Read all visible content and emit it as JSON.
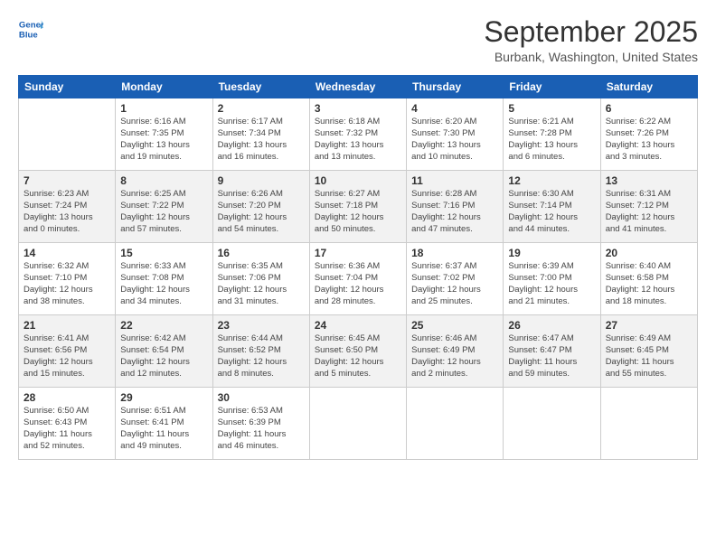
{
  "header": {
    "logo_line1": "General",
    "logo_line2": "Blue",
    "month_title": "September 2025",
    "location": "Burbank, Washington, United States"
  },
  "weekdays": [
    "Sunday",
    "Monday",
    "Tuesday",
    "Wednesday",
    "Thursday",
    "Friday",
    "Saturday"
  ],
  "rows": [
    [
      {
        "day": "",
        "info": ""
      },
      {
        "day": "1",
        "info": "Sunrise: 6:16 AM\nSunset: 7:35 PM\nDaylight: 13 hours\nand 19 minutes."
      },
      {
        "day": "2",
        "info": "Sunrise: 6:17 AM\nSunset: 7:34 PM\nDaylight: 13 hours\nand 16 minutes."
      },
      {
        "day": "3",
        "info": "Sunrise: 6:18 AM\nSunset: 7:32 PM\nDaylight: 13 hours\nand 13 minutes."
      },
      {
        "day": "4",
        "info": "Sunrise: 6:20 AM\nSunset: 7:30 PM\nDaylight: 13 hours\nand 10 minutes."
      },
      {
        "day": "5",
        "info": "Sunrise: 6:21 AM\nSunset: 7:28 PM\nDaylight: 13 hours\nand 6 minutes."
      },
      {
        "day": "6",
        "info": "Sunrise: 6:22 AM\nSunset: 7:26 PM\nDaylight: 13 hours\nand 3 minutes."
      }
    ],
    [
      {
        "day": "7",
        "info": "Sunrise: 6:23 AM\nSunset: 7:24 PM\nDaylight: 13 hours\nand 0 minutes."
      },
      {
        "day": "8",
        "info": "Sunrise: 6:25 AM\nSunset: 7:22 PM\nDaylight: 12 hours\nand 57 minutes."
      },
      {
        "day": "9",
        "info": "Sunrise: 6:26 AM\nSunset: 7:20 PM\nDaylight: 12 hours\nand 54 minutes."
      },
      {
        "day": "10",
        "info": "Sunrise: 6:27 AM\nSunset: 7:18 PM\nDaylight: 12 hours\nand 50 minutes."
      },
      {
        "day": "11",
        "info": "Sunrise: 6:28 AM\nSunset: 7:16 PM\nDaylight: 12 hours\nand 47 minutes."
      },
      {
        "day": "12",
        "info": "Sunrise: 6:30 AM\nSunset: 7:14 PM\nDaylight: 12 hours\nand 44 minutes."
      },
      {
        "day": "13",
        "info": "Sunrise: 6:31 AM\nSunset: 7:12 PM\nDaylight: 12 hours\nand 41 minutes."
      }
    ],
    [
      {
        "day": "14",
        "info": "Sunrise: 6:32 AM\nSunset: 7:10 PM\nDaylight: 12 hours\nand 38 minutes."
      },
      {
        "day": "15",
        "info": "Sunrise: 6:33 AM\nSunset: 7:08 PM\nDaylight: 12 hours\nand 34 minutes."
      },
      {
        "day": "16",
        "info": "Sunrise: 6:35 AM\nSunset: 7:06 PM\nDaylight: 12 hours\nand 31 minutes."
      },
      {
        "day": "17",
        "info": "Sunrise: 6:36 AM\nSunset: 7:04 PM\nDaylight: 12 hours\nand 28 minutes."
      },
      {
        "day": "18",
        "info": "Sunrise: 6:37 AM\nSunset: 7:02 PM\nDaylight: 12 hours\nand 25 minutes."
      },
      {
        "day": "19",
        "info": "Sunrise: 6:39 AM\nSunset: 7:00 PM\nDaylight: 12 hours\nand 21 minutes."
      },
      {
        "day": "20",
        "info": "Sunrise: 6:40 AM\nSunset: 6:58 PM\nDaylight: 12 hours\nand 18 minutes."
      }
    ],
    [
      {
        "day": "21",
        "info": "Sunrise: 6:41 AM\nSunset: 6:56 PM\nDaylight: 12 hours\nand 15 minutes."
      },
      {
        "day": "22",
        "info": "Sunrise: 6:42 AM\nSunset: 6:54 PM\nDaylight: 12 hours\nand 12 minutes."
      },
      {
        "day": "23",
        "info": "Sunrise: 6:44 AM\nSunset: 6:52 PM\nDaylight: 12 hours\nand 8 minutes."
      },
      {
        "day": "24",
        "info": "Sunrise: 6:45 AM\nSunset: 6:50 PM\nDaylight: 12 hours\nand 5 minutes."
      },
      {
        "day": "25",
        "info": "Sunrise: 6:46 AM\nSunset: 6:49 PM\nDaylight: 12 hours\nand 2 minutes."
      },
      {
        "day": "26",
        "info": "Sunrise: 6:47 AM\nSunset: 6:47 PM\nDaylight: 11 hours\nand 59 minutes."
      },
      {
        "day": "27",
        "info": "Sunrise: 6:49 AM\nSunset: 6:45 PM\nDaylight: 11 hours\nand 55 minutes."
      }
    ],
    [
      {
        "day": "28",
        "info": "Sunrise: 6:50 AM\nSunset: 6:43 PM\nDaylight: 11 hours\nand 52 minutes."
      },
      {
        "day": "29",
        "info": "Sunrise: 6:51 AM\nSunset: 6:41 PM\nDaylight: 11 hours\nand 49 minutes."
      },
      {
        "day": "30",
        "info": "Sunrise: 6:53 AM\nSunset: 6:39 PM\nDaylight: 11 hours\nand 46 minutes."
      },
      {
        "day": "",
        "info": ""
      },
      {
        "day": "",
        "info": ""
      },
      {
        "day": "",
        "info": ""
      },
      {
        "day": "",
        "info": ""
      }
    ]
  ]
}
